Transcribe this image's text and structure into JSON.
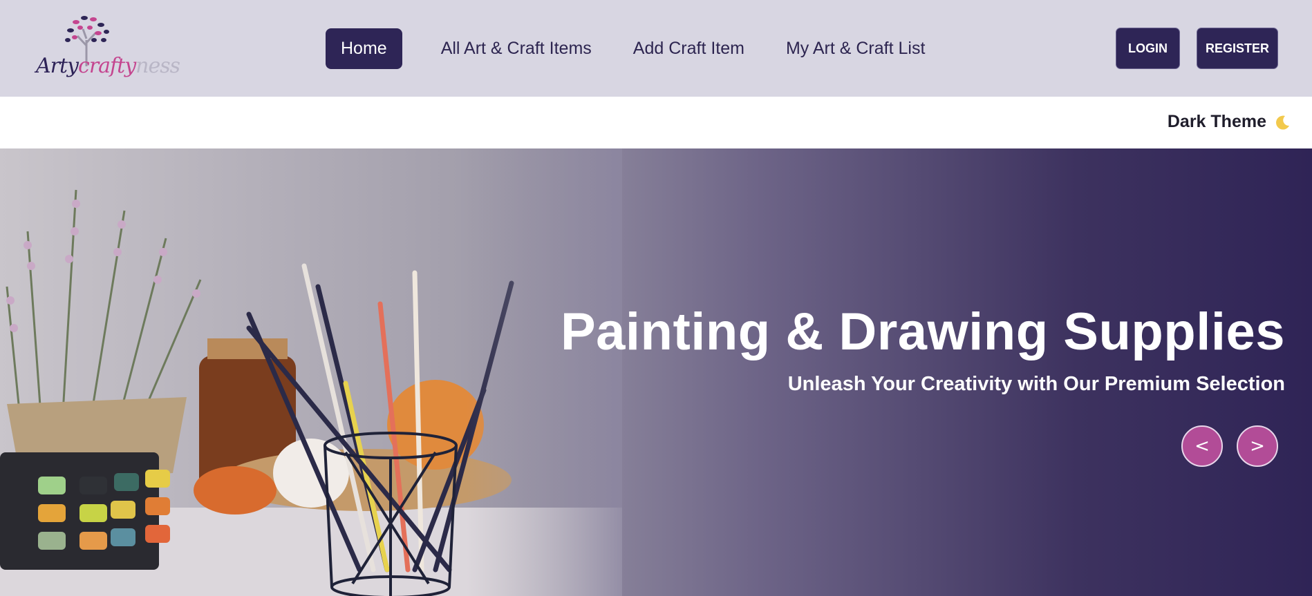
{
  "brand": {
    "logo_part1": "Arty",
    "logo_part2": "crafty",
    "logo_part3": "ness",
    "icon": "tree-logo-icon"
  },
  "nav": {
    "items": [
      {
        "label": "Home",
        "active": true
      },
      {
        "label": "All Art & Craft Items",
        "active": false
      },
      {
        "label": "Add Craft Item",
        "active": false
      },
      {
        "label": "My Art & Craft List",
        "active": false
      }
    ]
  },
  "auth": {
    "login_label": "LOGIN",
    "register_label": "REGISTER"
  },
  "theme_toggle": {
    "label": "Dark Theme",
    "icon": "moon-icon"
  },
  "hero": {
    "title": "Painting & Drawing Supplies",
    "subtitle": "Unleash Your Creativity with Our Premium Selection",
    "prev_label": "<",
    "next_label": ">"
  },
  "colors": {
    "primary": "#2e2556",
    "accent": "#b24c97",
    "navbar_bg": "#d8d6e2"
  }
}
